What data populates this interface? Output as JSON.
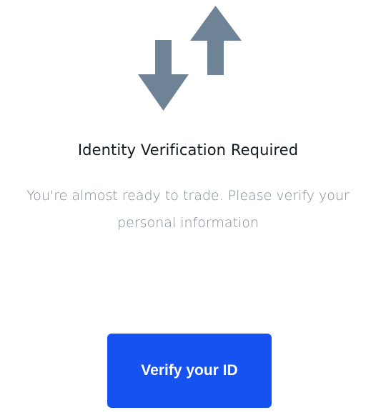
{
  "icon": {
    "name": "swap-arrows-icon",
    "color": "#6f8396"
  },
  "heading": "Identity Verification Required",
  "message": "You're almost ready to trade. Please verify your personal information",
  "button": {
    "label": "Verify your ID",
    "color": "#1652f0"
  }
}
